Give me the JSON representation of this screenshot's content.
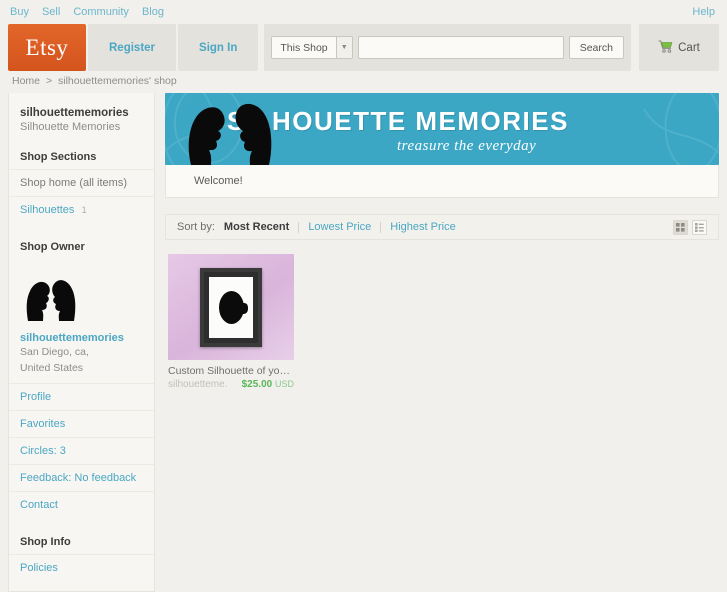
{
  "topbar": {
    "nav": [
      {
        "label": "Buy"
      },
      {
        "label": "Sell"
      },
      {
        "label": "Community"
      },
      {
        "label": "Blog"
      }
    ],
    "help_label": "Help"
  },
  "header": {
    "logo_text": "Etsy",
    "register_label": "Register",
    "signin_label": "Sign In",
    "search": {
      "scope_label": "This Shop",
      "value": "",
      "placeholder": "",
      "button_label": "Search"
    },
    "cart_label": "Cart",
    "cart_icon": "shopping-cart-icon",
    "cart_color": "#7ac143"
  },
  "breadcrumb": {
    "home_label": "Home",
    "separator": ">",
    "current_label": "silhouettememories' shop"
  },
  "sidebar": {
    "shop_name": "silhouettememories",
    "shop_subtitle": "Silhouette Memories",
    "sections_heading": "Shop Sections",
    "sections": [
      {
        "label": "Shop home (all items)",
        "count": ""
      },
      {
        "label": "Silhouettes",
        "count": "1"
      }
    ],
    "owner_heading": "Shop Owner",
    "owner_avatar_icon": "double-silhouette-avatar",
    "owner_name": "silhouettememories",
    "owner_location_line1": "San Diego, ca,",
    "owner_location_line2": "United States",
    "owner_links": [
      {
        "label": "Profile"
      },
      {
        "label": "Favorites"
      },
      {
        "label": "Circles: 3"
      },
      {
        "label": "Feedback: No feedback"
      },
      {
        "label": "Contact"
      }
    ],
    "info_heading": "Shop Info",
    "info_links": [
      {
        "label": "Policies"
      }
    ]
  },
  "banner": {
    "title": "SILHOUETTE MEMORIES",
    "tagline": "treasure the everyday",
    "background_color": "#3ba7c4",
    "silhouette_icon": "couple-silhouette-icon"
  },
  "announcement": {
    "text": "Welcome!"
  },
  "sortbar": {
    "label": "Sort by:",
    "options": [
      {
        "label": "Most Recent",
        "active": true
      },
      {
        "label": "Lowest Price",
        "active": false
      },
      {
        "label": "Highest Price",
        "active": false
      }
    ],
    "grid_view_icon": "grid-view-icon",
    "list_view_icon": "list-view-icon",
    "active_view": "grid"
  },
  "listings": [
    {
      "title": "Custom Silhouette of your ...",
      "shop": "silhouetteme...",
      "price": "$25.00",
      "currency": "USD",
      "image_icon": "framed-silhouette-portrait"
    }
  ]
}
